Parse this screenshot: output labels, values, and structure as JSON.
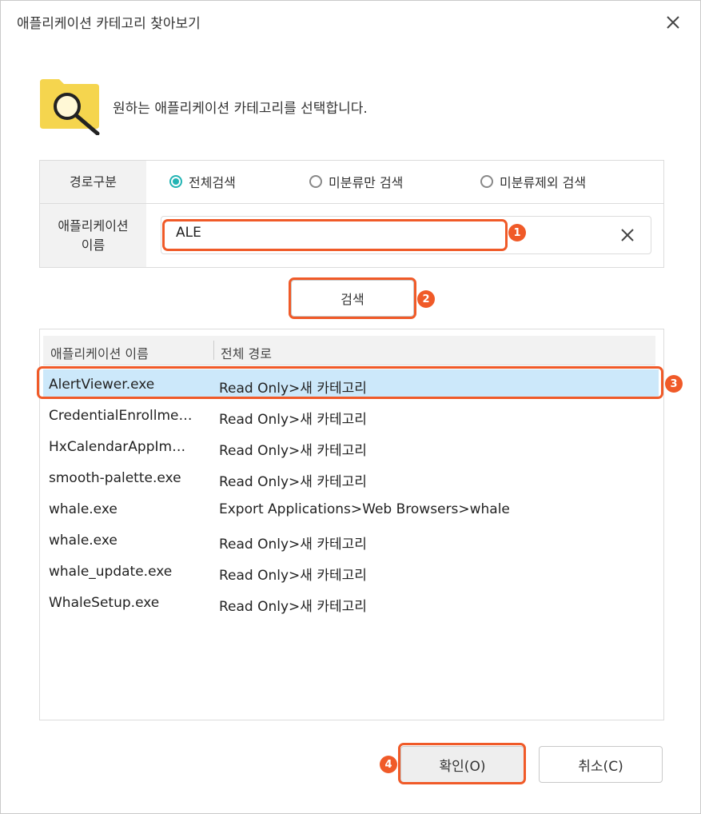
{
  "dialog": {
    "title": "애플리케이션 카테고리 찾아보기"
  },
  "instruction": "원하는 애플리케이션 카테고리를 선택합니다.",
  "filter": {
    "path_label": "경로구분",
    "options": [
      {
        "label": "전체검색",
        "checked": true
      },
      {
        "label": "미분류만 검색",
        "checked": false
      },
      {
        "label": "미분류제외 검색",
        "checked": false
      }
    ],
    "name_label_line1": "애플리케이션",
    "name_label_line2": "이름",
    "name_value": "ALE"
  },
  "search_button": "검색",
  "table": {
    "headers": [
      "애플리케이션 이름",
      "전체 경로"
    ],
    "rows": [
      {
        "name": "AlertViewer.exe",
        "path": "Read Only>새 카테고리",
        "selected": true
      },
      {
        "name": "CredentialEnrollme…",
        "path": "Read Only>새 카테고리",
        "selected": false
      },
      {
        "name": "HxCalendarAppIm…",
        "path": "Read Only>새 카테고리",
        "selected": false
      },
      {
        "name": "smooth-palette.exe",
        "path": "Read Only>새 카테고리",
        "selected": false
      },
      {
        "name": "whale.exe",
        "path": "Export Applications>Web Browsers>whale",
        "selected": false
      },
      {
        "name": "whale.exe",
        "path": "Read Only>새 카테고리",
        "selected": false
      },
      {
        "name": "whale_update.exe",
        "path": "Read Only>새 카테고리",
        "selected": false
      },
      {
        "name": "WhaleSetup.exe",
        "path": "Read Only>새 카테고리",
        "selected": false
      }
    ]
  },
  "buttons": {
    "ok": "확인(O)",
    "cancel": "취소(C)"
  },
  "badges": [
    "1",
    "2",
    "3",
    "4"
  ],
  "colors": {
    "accent": "#f05a28",
    "radio": "#23b4b4",
    "selected_row": "#cce8fa",
    "folder": "#f5d54e"
  }
}
